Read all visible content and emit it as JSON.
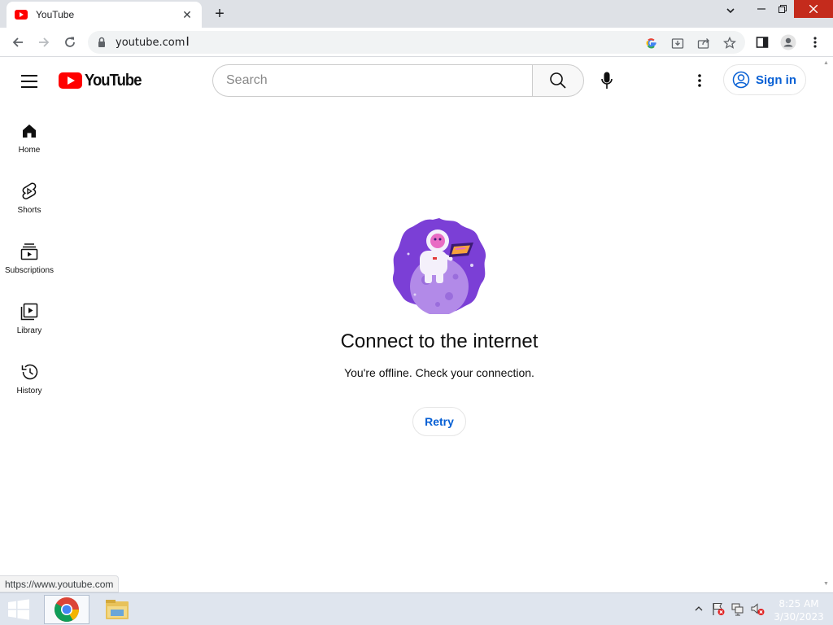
{
  "browser": {
    "tab_title": "YouTube",
    "url": "youtube.com",
    "status_url": "https://www.youtube.com"
  },
  "masthead": {
    "logo_text": "YouTube",
    "search_placeholder": "Search",
    "signin_label": "Sign in"
  },
  "guide": [
    {
      "label": "Home",
      "icon": "home-icon"
    },
    {
      "label": "Shorts",
      "icon": "shorts-icon"
    },
    {
      "label": "Subscriptions",
      "icon": "subscriptions-icon"
    },
    {
      "label": "Library",
      "icon": "library-icon"
    },
    {
      "label": "History",
      "icon": "history-icon"
    }
  ],
  "offline": {
    "title": "Connect to the internet",
    "message": "You're offline. Check your connection.",
    "retry_label": "Retry"
  },
  "taskbar": {
    "time": "8:25 AM",
    "date": "3/30/2023"
  },
  "colors": {
    "brand_red": "#ff0000",
    "link_blue": "#065fd4",
    "illustration_purple": "#7b3fd6"
  }
}
